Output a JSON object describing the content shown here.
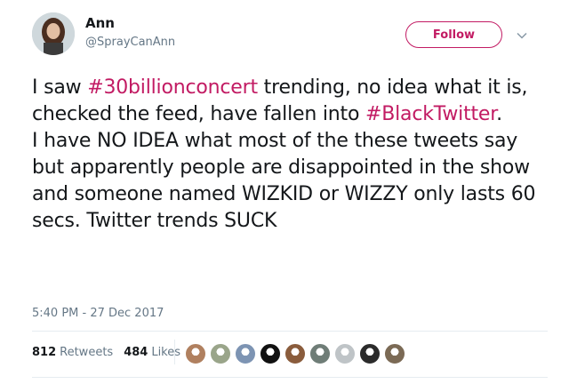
{
  "author": {
    "name": "Ann",
    "handle": "@SprayCanAnn"
  },
  "follow_label": "Follow",
  "tweet": {
    "line1_pre": "I saw ",
    "hashtag1": "#30billionconcert",
    "line1_post": " trending, no idea what it is, checked the feed, have fallen into ",
    "hashtag2": "#BlackTwitter",
    "line1_end": ".",
    "paragraph2": "I have NO IDEA what most of the these tweets say but apparently people are disappointed in the show and someone named WIZKID or WIZZY only lasts 60 secs. Twitter trends SUCK"
  },
  "timestamp": "5:40 PM - 27 Dec 2017",
  "stats": {
    "retweets_count": "812",
    "retweets_label": "Retweets",
    "likes_count": "484",
    "likes_label": "Likes"
  },
  "colors": {
    "accent": "#c21b63",
    "muted": "#657786"
  },
  "liker_avatars": [
    "#b0805f",
    "#9aa58a",
    "#7d94b3",
    "#111111",
    "#8a5c3c",
    "#6f7d77",
    "#bfc4c7",
    "#2b2b2b",
    "#7b6a55"
  ]
}
